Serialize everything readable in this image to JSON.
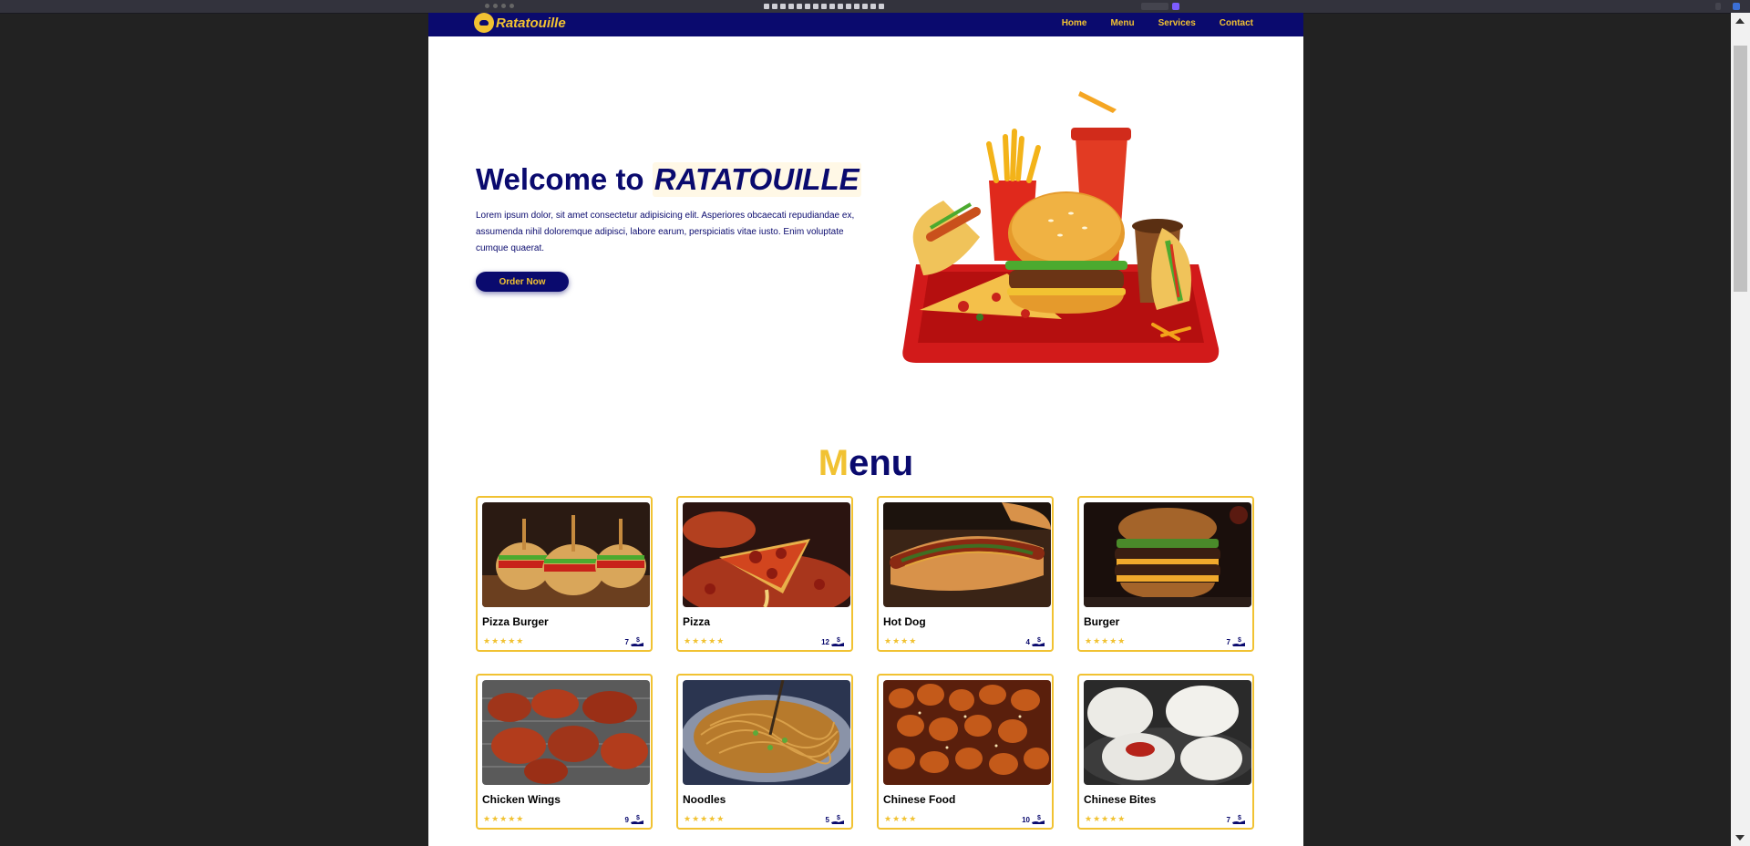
{
  "brand": {
    "name": "Ratatouille",
    "primary_color": "#0a0a6e",
    "accent_color": "#f1c232"
  },
  "nav": {
    "links": [
      "Home",
      "Menu",
      "Services",
      "Contact"
    ]
  },
  "hero": {
    "title_prefix": "Welcome to",
    "title_highlight": "RATATOUILLE",
    "text": "Lorem ipsum dolor, sit amet consectetur adipisicing elit. Asperiores obcaecati repudiandae ex, assumenda nihil doloremque adipisci, labore earum, perspiciatis vitae iusto. Enim voluptate cumque quaerat.",
    "button": "Order Now"
  },
  "menu": {
    "heading_first": "M",
    "heading_rest": "enu",
    "items": [
      {
        "name": "Pizza Burger",
        "stars": 5,
        "price": "7",
        "currency": "$",
        "icon": "hand-money-icon"
      },
      {
        "name": "Pizza",
        "stars": 5,
        "price": "12",
        "currency": "$",
        "icon": "hand-money-icon"
      },
      {
        "name": "Hot Dog",
        "stars": 4,
        "price": "4",
        "currency": "$",
        "icon": "hand-money-icon"
      },
      {
        "name": "Burger",
        "stars": 5,
        "price": "7",
        "currency": "$",
        "icon": "hand-money-icon"
      },
      {
        "name": "Chicken Wings",
        "stars": 5,
        "price": "9",
        "currency": "$",
        "icon": "hand-money-icon"
      },
      {
        "name": "Noodles",
        "stars": 5,
        "price": "5",
        "currency": "$",
        "icon": "hand-money-icon"
      },
      {
        "name": "Chinese Food",
        "stars": 4,
        "price": "10",
        "currency": "$",
        "icon": "hand-money-icon"
      },
      {
        "name": "Chinese Bites",
        "stars": 5,
        "price": "7",
        "currency": "$",
        "icon": "hand-money-icon"
      }
    ]
  }
}
